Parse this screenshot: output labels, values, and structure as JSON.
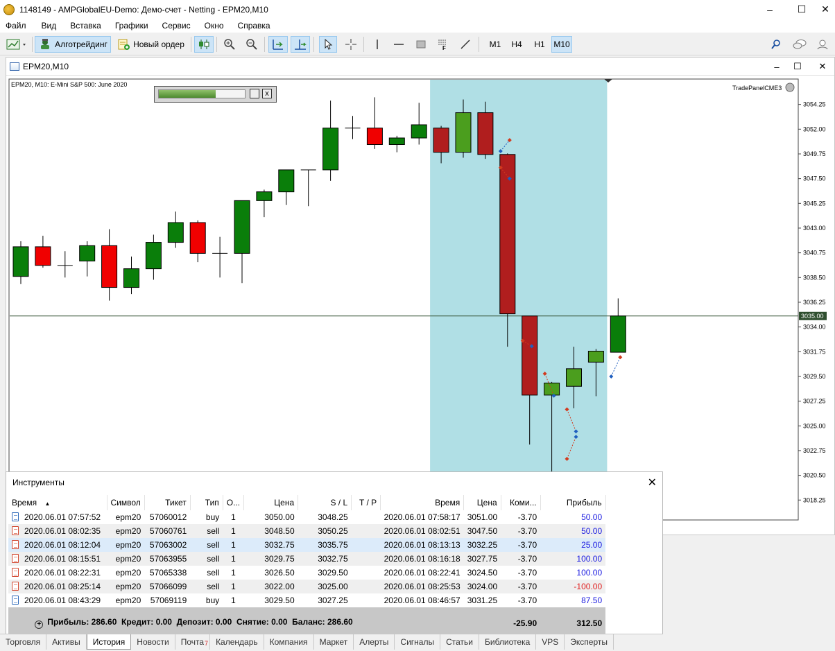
{
  "window": {
    "title": "1148149 - AMPGlobalEU-Demo: Демо-счет - Netting - EPM20,M10"
  },
  "menu": [
    "Файл",
    "Вид",
    "Вставка",
    "Графики",
    "Сервис",
    "Окно",
    "Справка"
  ],
  "toolbar": {
    "algo_label": "Алготрейдинг",
    "new_order_label": "Новый ордер",
    "timeframes": [
      "M1",
      "H4",
      "H1",
      "M10"
    ],
    "active_timeframe": "M10"
  },
  "chart": {
    "tab_title": "EPM20,M10",
    "header": "EPM20, M10:  E-Mini S&P 500: June 2020",
    "indicator_label": "TradePanelCME3",
    "current_price_label": "3035.00",
    "colors": {
      "highlight": "#b0dfe5",
      "bull": "#0a7e0a",
      "bull_light": "#4b9e1e",
      "bear": "#f00000",
      "bear_dark": "#b01e1e",
      "price_line": "#2f4f2f"
    }
  },
  "chart_data": {
    "type": "candlestick",
    "y_ticks": [
      "3054.25",
      "3052.00",
      "3049.75",
      "3047.50",
      "3045.25",
      "3043.00",
      "3040.75",
      "3038.50",
      "3036.25",
      "3034.00",
      "3031.75",
      "3029.50",
      "3027.25",
      "3025.00",
      "3022.75",
      "3020.50",
      "3018.25"
    ],
    "ylim": [
      3016.5,
      3056.5
    ],
    "current_price": 3035.0,
    "candles": [
      {
        "o": 3038.6,
        "h": 3041.8,
        "l": 3037.9,
        "c": 3041.3
      },
      {
        "o": 3041.3,
        "h": 3042.3,
        "l": 3039.4,
        "c": 3039.6
      },
      {
        "o": 3039.6,
        "h": 3040.9,
        "l": 3038.5,
        "c": 3039.6
      },
      {
        "o": 3040.0,
        "h": 3041.8,
        "l": 3038.6,
        "c": 3041.4
      },
      {
        "o": 3041.4,
        "h": 3042.9,
        "l": 3036.4,
        "c": 3037.6
      },
      {
        "o": 3037.6,
        "h": 3040.4,
        "l": 3037.0,
        "c": 3039.3
      },
      {
        "o": 3039.3,
        "h": 3042.4,
        "l": 3038.3,
        "c": 3041.7
      },
      {
        "o": 3041.7,
        "h": 3044.5,
        "l": 3041.2,
        "c": 3043.5
      },
      {
        "o": 3043.5,
        "h": 3043.7,
        "l": 3039.9,
        "c": 3040.7
      },
      {
        "o": 3040.7,
        "h": 3042.2,
        "l": 3038.5,
        "c": 3040.7
      },
      {
        "o": 3040.7,
        "h": 3045.4,
        "l": 3038.0,
        "c": 3045.5
      },
      {
        "o": 3045.5,
        "h": 3046.5,
        "l": 3044.0,
        "c": 3046.3
      },
      {
        "o": 3046.3,
        "h": 3047.8,
        "l": 3045.1,
        "c": 3048.3
      },
      {
        "o": 3048.3,
        "h": 3048.3,
        "l": 3045.0,
        "c": 3048.3
      },
      {
        "o": 3048.3,
        "h": 3054.6,
        "l": 3047.3,
        "c": 3052.1
      },
      {
        "o": 3052.1,
        "h": 3053.2,
        "l": 3051.1,
        "c": 3052.1
      },
      {
        "o": 3052.1,
        "h": 3054.9,
        "l": 3050.2,
        "c": 3050.6
      },
      {
        "o": 3050.6,
        "h": 3051.4,
        "l": 3049.9,
        "c": 3051.2
      },
      {
        "o": 3051.2,
        "h": 3054.4,
        "l": 3050.6,
        "c": 3052.4
      },
      {
        "o": 3052.1,
        "h": 3052.3,
        "l": 3048.9,
        "c": 3049.9
      },
      {
        "o": 3049.9,
        "h": 3054.7,
        "l": 3049.4,
        "c": 3053.5
      },
      {
        "o": 3053.5,
        "h": 3054.5,
        "l": 3049.3,
        "c": 3049.7
      },
      {
        "o": 3049.7,
        "h": 3049.8,
        "l": 3032.2,
        "c": 3035.2
      },
      {
        "o": 3035.0,
        "h": 3035.0,
        "l": 3023.3,
        "c": 3027.8
      },
      {
        "o": 3027.8,
        "h": 3029.0,
        "l": 3020.6,
        "c": 3028.9
      },
      {
        "o": 3028.6,
        "h": 3032.2,
        "l": 3026.6,
        "c": 3030.2
      },
      {
        "o": 3030.8,
        "h": 3032.0,
        "l": 3027.7,
        "c": 3031.8
      },
      {
        "o": 3031.7,
        "h": 3036.6,
        "l": 3031.7,
        "c": 3035.0
      }
    ],
    "highlight_candles": [
      19,
      26
    ]
  },
  "panel": {
    "title": "Инструменты",
    "columns": [
      "Время",
      "Символ",
      "Тикет",
      "Тип",
      "О...",
      "Цена",
      "S / L",
      "T / P",
      "Время",
      "Цена",
      "Коми...",
      "Прибыль"
    ],
    "rows": [
      {
        "icon": "buy-order-icon",
        "side": "buy",
        "time_open": "2020.06.01 07:57:52",
        "symbol": "epm20",
        "ticket": "57060012",
        "type": "buy",
        "volume": "1",
        "price": "3050.00",
        "sl": "3048.25",
        "tp": "",
        "time_close": "2020.06.01 07:58:17",
        "close_price": "3051.00",
        "commission": "-3.70",
        "profit": "50.00",
        "profit_sign": "pos"
      },
      {
        "icon": "sell-order-icon",
        "side": "sell",
        "time_open": "2020.06.01 08:02:35",
        "symbol": "epm20",
        "ticket": "57060761",
        "type": "sell",
        "volume": "1",
        "price": "3048.50",
        "sl": "3050.25",
        "tp": "",
        "time_close": "2020.06.01 08:02:51",
        "close_price": "3047.50",
        "commission": "-3.70",
        "profit": "50.00",
        "profit_sign": "pos"
      },
      {
        "icon": "sell-order-icon",
        "side": "sell",
        "time_open": "2020.06.01 08:12:04",
        "symbol": "epm20",
        "ticket": "57063002",
        "type": "sell",
        "volume": "1",
        "price": "3032.75",
        "sl": "3035.75",
        "tp": "",
        "time_close": "2020.06.01 08:13:13",
        "close_price": "3032.25",
        "commission": "-3.70",
        "profit": "25.00",
        "profit_sign": "pos"
      },
      {
        "icon": "sell-order-icon",
        "side": "sell",
        "time_open": "2020.06.01 08:15:51",
        "symbol": "epm20",
        "ticket": "57063955",
        "type": "sell",
        "volume": "1",
        "price": "3029.75",
        "sl": "3032.75",
        "tp": "",
        "time_close": "2020.06.01 08:16:18",
        "close_price": "3027.75",
        "commission": "-3.70",
        "profit": "100.00",
        "profit_sign": "pos"
      },
      {
        "icon": "sell-order-icon",
        "side": "sell",
        "time_open": "2020.06.01 08:22:31",
        "symbol": "epm20",
        "ticket": "57065338",
        "type": "sell",
        "volume": "1",
        "price": "3026.50",
        "sl": "3029.50",
        "tp": "",
        "time_close": "2020.06.01 08:22:41",
        "close_price": "3024.50",
        "commission": "-3.70",
        "profit": "100.00",
        "profit_sign": "pos"
      },
      {
        "icon": "sell-order-icon",
        "side": "sell",
        "time_open": "2020.06.01 08:25:14",
        "symbol": "epm20",
        "ticket": "57066099",
        "type": "sell",
        "volume": "1",
        "price": "3022.00",
        "sl": "3025.00",
        "tp": "",
        "time_close": "2020.06.01 08:25:53",
        "close_price": "3024.00",
        "commission": "-3.70",
        "profit": "-100.00",
        "profit_sign": "neg"
      },
      {
        "icon": "buy-order-icon",
        "side": "buy",
        "time_open": "2020.06.01 08:43:29",
        "symbol": "epm20",
        "ticket": "57069119",
        "type": "buy",
        "volume": "1",
        "price": "3029.50",
        "sl": "3027.25",
        "tp": "",
        "time_close": "2020.06.01 08:46:57",
        "close_price": "3031.25",
        "commission": "-3.70",
        "profit": "87.50",
        "profit_sign": "pos"
      }
    ],
    "summary": {
      "text": "Прибыль: 286.60  Кредит: 0.00  Депозит: 0.00  Снятие: 0.00  Баланс: 286.60",
      "commission_total": "-25.90",
      "profit_total": "312.50"
    }
  },
  "tabs": [
    {
      "label": "Торговля"
    },
    {
      "label": "Активы"
    },
    {
      "label": "История",
      "active": true
    },
    {
      "label": "Новости"
    },
    {
      "label": "Почта",
      "badge": "7"
    },
    {
      "label": "Календарь"
    },
    {
      "label": "Компания"
    },
    {
      "label": "Маркет"
    },
    {
      "label": "Алерты"
    },
    {
      "label": "Сигналы"
    },
    {
      "label": "Статьи"
    },
    {
      "label": "Библиотека"
    },
    {
      "label": "VPS"
    },
    {
      "label": "Эксперты"
    }
  ]
}
